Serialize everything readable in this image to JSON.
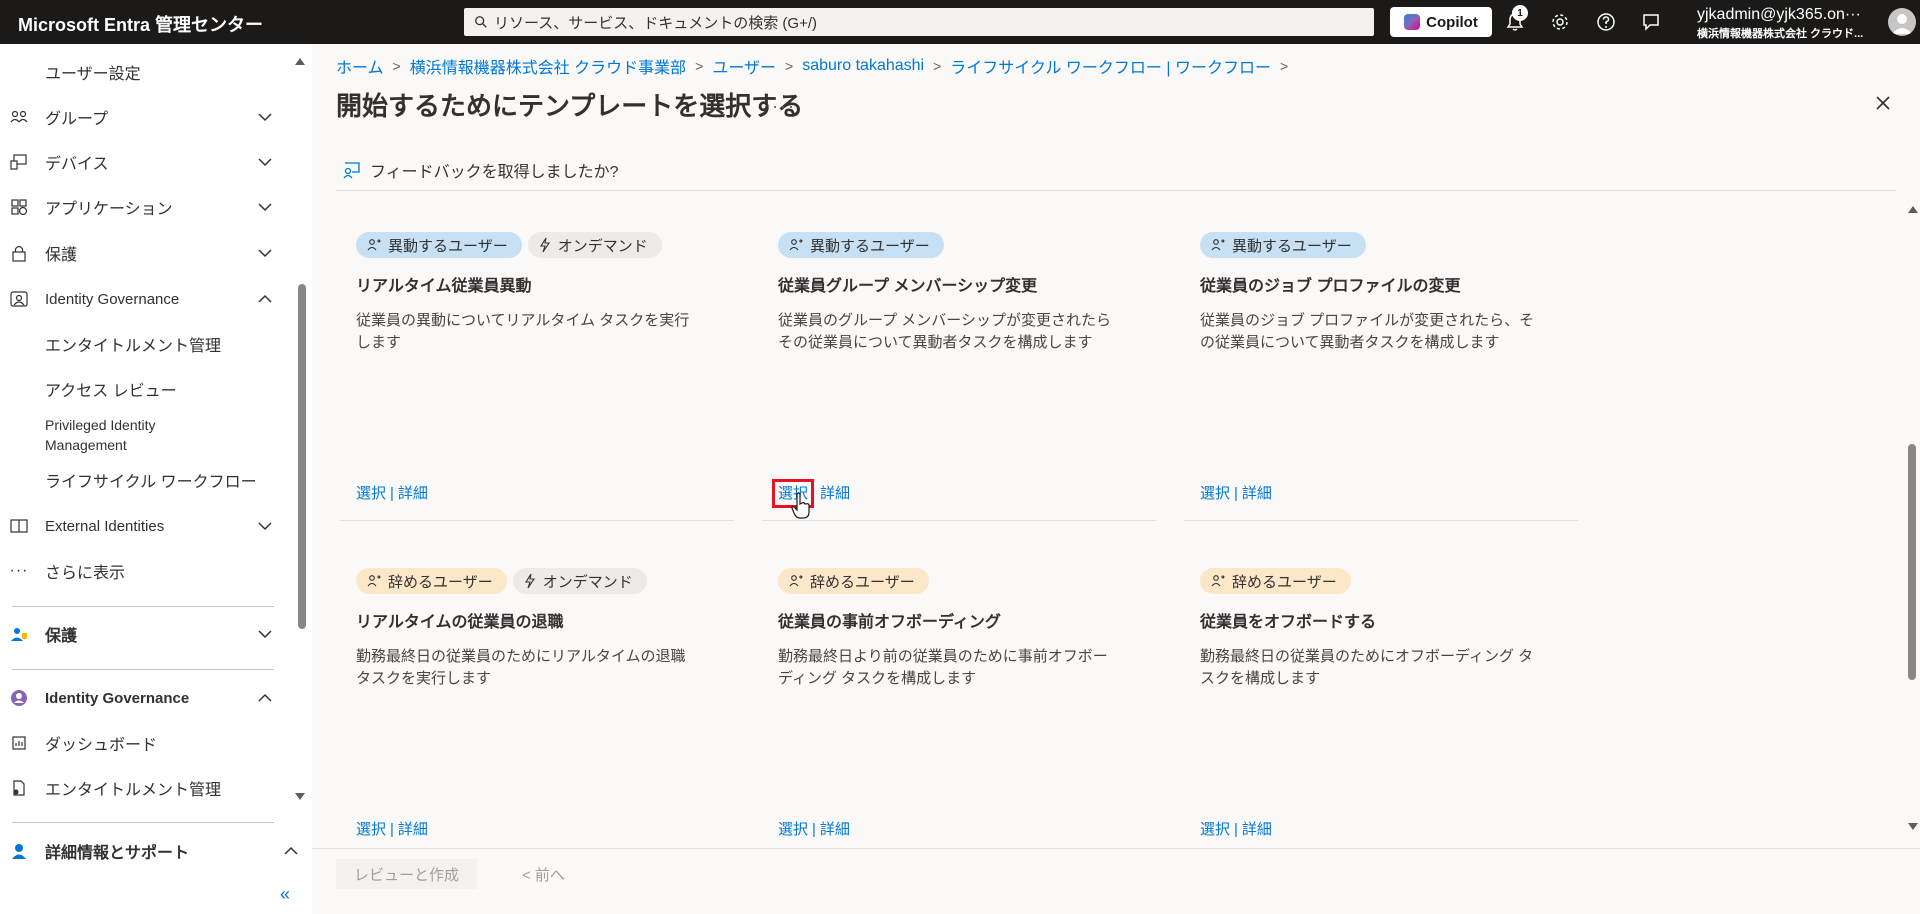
{
  "app": {
    "brand": "Microsoft Entra 管理センター",
    "search_placeholder": "リソース、サービス、ドキュメントの検索 (G+/)",
    "copilot_label": "Copilot",
    "notification_count": "1",
    "user_email": "yjkadmin@yjk365.on···",
    "user_tenant": "横浜情報機器株式会社 クラウド..."
  },
  "sidebar": {
    "items": [
      {
        "label": "ユーザー設定",
        "icon": "none"
      },
      {
        "label": "グループ",
        "icon": "group-icon"
      },
      {
        "label": "デバイス",
        "icon": "device-icon"
      },
      {
        "label": "アプリケーション",
        "icon": "apps-icon"
      },
      {
        "label": "保護",
        "icon": "lock-icon"
      },
      {
        "label": "Identity Governance",
        "icon": "governance-icon"
      },
      {
        "label": "エンタイトルメント管理",
        "icon": "none"
      },
      {
        "label": "アクセス レビュー",
        "icon": "none"
      },
      {
        "label": "Privileged Identity Management",
        "icon": "none"
      },
      {
        "label": "ライフサイクル ワークフロー",
        "icon": "none"
      },
      {
        "label": "External Identities",
        "icon": "external-icon"
      },
      {
        "label": "さらに表示",
        "icon": "more-icon"
      },
      {
        "label": "保護",
        "icon": "protection-icon"
      },
      {
        "label": "Identity Governance",
        "icon": "governance-icon"
      },
      {
        "label": "ダッシュボード",
        "icon": "dashboard-icon"
      },
      {
        "label": "エンタイトルメント管理",
        "icon": "entitlement-icon"
      },
      {
        "label": "詳細情報とサポート",
        "icon": "support-icon"
      }
    ],
    "collapse_label": "«"
  },
  "breadcrumb": [
    "ホーム",
    "横浜情報機器株式会社 クラウド事業部",
    "ユーザー",
    "saburo takahashi",
    "ライフサイクル ワークフロー | ワークフロー"
  ],
  "page": {
    "title": "開始するためにテンプレートを選択する",
    "more": "···",
    "feedback": "フィードバックを取得しましたか?"
  },
  "tags": {
    "mover": "異動するユーザー",
    "leaver": "辞めるユーザー",
    "ondemand": "オンデマンド"
  },
  "actions": {
    "select": "選択",
    "details": "詳細",
    "sep": "|"
  },
  "cards": [
    {
      "title": "リアルタイム従業員異動",
      "desc": "従業員の異動についてリアルタイム タスクを実行します"
    },
    {
      "title": "従業員グループ メンバーシップ変更",
      "desc": "従業員のグループ メンバーシップが変更されたらその従業員について異動者タスクを構成します"
    },
    {
      "title": "従業員のジョブ プロファイルの変更",
      "desc": "従業員のジョブ プロファイルが変更されたら、その従業員について異動者タスクを構成します"
    },
    {
      "title": "リアルタイムの従業員の退職",
      "desc": "勤務最終日の従業員のためにリアルタイムの退職タスクを実行します"
    },
    {
      "title": "従業員の事前オフボーディング",
      "desc": "勤務最終日より前の従業員のために事前オフボーディング タスクを構成します"
    },
    {
      "title": "従業員をオフボードする",
      "desc": "勤務最終日の従業員のためにオフボーディング タスクを構成します"
    }
  ],
  "footer": {
    "review_create": "レビューと作成",
    "previous": "< 前へ"
  }
}
